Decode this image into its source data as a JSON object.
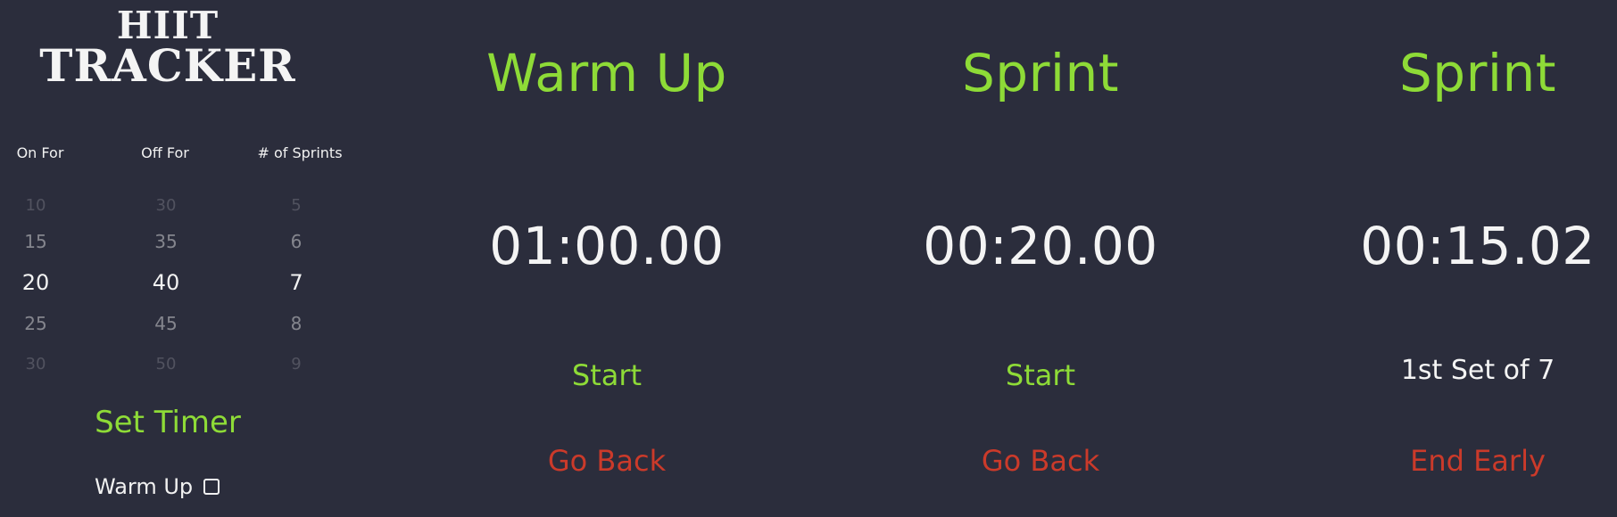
{
  "app": {
    "title_line_1": "HIIT",
    "title_line_2": "TRACKER"
  },
  "setup": {
    "labels": {
      "on_for": "On For",
      "off_for": "Off For",
      "sprints": "# of Sprints"
    },
    "on_for": {
      "values": [
        "10",
        "15",
        "20",
        "25",
        "30"
      ],
      "selected": "20"
    },
    "off_for": {
      "values": [
        "30",
        "35",
        "40",
        "45",
        "50"
      ],
      "selected": "40"
    },
    "sprints": {
      "values": [
        "5",
        "6",
        "7",
        "8",
        "9"
      ],
      "selected": "7"
    },
    "set_timer_label": "Set Timer",
    "warmup_label": "Warm Up"
  },
  "panels": [
    {
      "title": "Warm Up",
      "time": "01:00.00",
      "action_label": "Start",
      "secondary_label": "Go Back"
    },
    {
      "title": "Sprint",
      "time": "00:20.00",
      "action_label": "Start",
      "secondary_label": "Go Back"
    },
    {
      "title": "Sprint",
      "time": "00:15.02",
      "status_label": "1st Set of 7",
      "secondary_label": "End Early"
    }
  ],
  "colors": {
    "background": "#2b2d3c",
    "accent_green": "#8edb37",
    "accent_red": "#cb3a2a",
    "text_white": "#f4f4f4"
  }
}
